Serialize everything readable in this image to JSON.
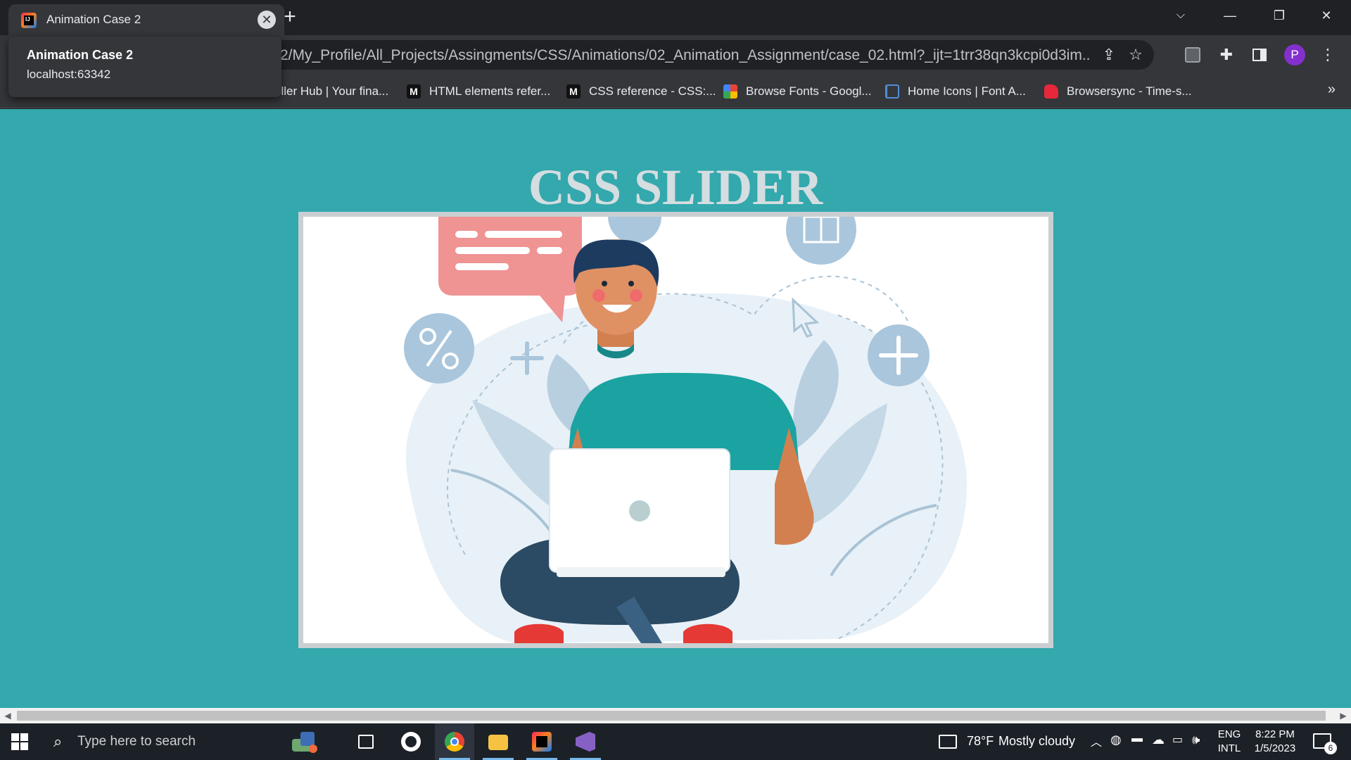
{
  "browser": {
    "tab": {
      "title": "Animation Case 2",
      "favicon": "intellij-icon",
      "close_glyph": "✕"
    },
    "new_tab_glyph": "+",
    "window_controls": {
      "tab_search": "⌵",
      "minimize": "—",
      "restore": "❐",
      "close": "✕"
    },
    "tooltip": {
      "title": "Animation Case 2",
      "host": "localhost:63342"
    },
    "address_bar": {
      "url": "2/My_Profile/All_Projects/Assingments/CSS/Animations/02_Animation_Assignment/case_02.html?_ijt=1trr38qn3kcpi0d3im..."
    },
    "profile_initial": "P",
    "bookmarks": [
      {
        "label": "eller Hub | Your fina...",
        "icon": "seller-hub-icon",
        "color": "#f5a623"
      },
      {
        "label": "HTML elements refer...",
        "icon": "mdn-icon",
        "color": "#ffffff"
      },
      {
        "label": "CSS reference - CSS:...",
        "icon": "mdn-icon",
        "color": "#ffffff"
      },
      {
        "label": "Browse Fonts - Googl...",
        "icon": "google-fonts-icon",
        "color": "#4285f4"
      },
      {
        "label": "Home Icons | Font A...",
        "icon": "font-awesome-flag-icon",
        "color": "#538dd7"
      },
      {
        "label": "Browsersync - Time-s...",
        "icon": "browsersync-icon",
        "color": "#e8283a"
      }
    ],
    "bookmarks_more": "»"
  },
  "page": {
    "title": "CSS SLIDER",
    "background": "#33a8ad",
    "slide": {
      "description": "illustration-person-with-laptop"
    }
  },
  "taskbar": {
    "search_placeholder": "Type here to search",
    "weather": {
      "temp": "78°F",
      "condition": "Mostly cloudy"
    },
    "language": {
      "line1": "ENG",
      "line2": "INTL"
    },
    "clock": {
      "time": "8:22 PM",
      "date": "1/5/2023"
    },
    "notifications": "6"
  }
}
